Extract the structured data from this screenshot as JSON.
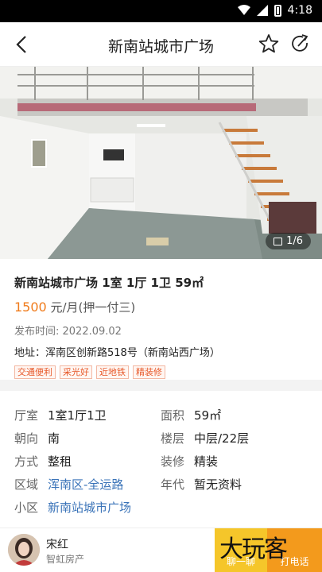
{
  "status_bar": {
    "time": "4:18"
  },
  "header": {
    "title": "新南站城市广场"
  },
  "gallery": {
    "counter": "1/6"
  },
  "listing": {
    "headline": "新南站城市广场 1室 1厅 1卫 59㎡",
    "price": "1500",
    "price_unit": " 元/月(押一付三)",
    "published": "发布时间: 2022.09.02",
    "address": "地址：浑南区创新路518号（新南站西广场）",
    "tags": [
      "交通便利",
      "采光好",
      "近地铁",
      "精装修"
    ]
  },
  "details": {
    "rows": [
      [
        {
          "label": "厅室",
          "value": "1室1厅1卫"
        },
        {
          "label": "面积",
          "value": "59㎡"
        }
      ],
      [
        {
          "label": "朝向",
          "value": "南"
        },
        {
          "label": "楼层",
          "value": "中层/22层"
        }
      ],
      [
        {
          "label": "方式",
          "value": "整租"
        },
        {
          "label": "装修",
          "value": "精装"
        }
      ],
      [
        {
          "label": "区域",
          "value": "浑南区-全运路"
        },
        {
          "label": "年代",
          "value": "暂无资料"
        }
      ],
      [
        {
          "label": "小区",
          "value": "新南站城市广场"
        }
      ]
    ]
  },
  "agent": {
    "name": "宋红",
    "company": "智虹房产"
  },
  "actions": {
    "chat_label": "聊一聊",
    "call_label": "打电话"
  },
  "watermark": "大玩客",
  "colors": {
    "price": "#f07b1b",
    "tag": "#e7592a",
    "link": "#3a73b8",
    "chat": "#f5c62a",
    "call": "#f39a1c"
  }
}
